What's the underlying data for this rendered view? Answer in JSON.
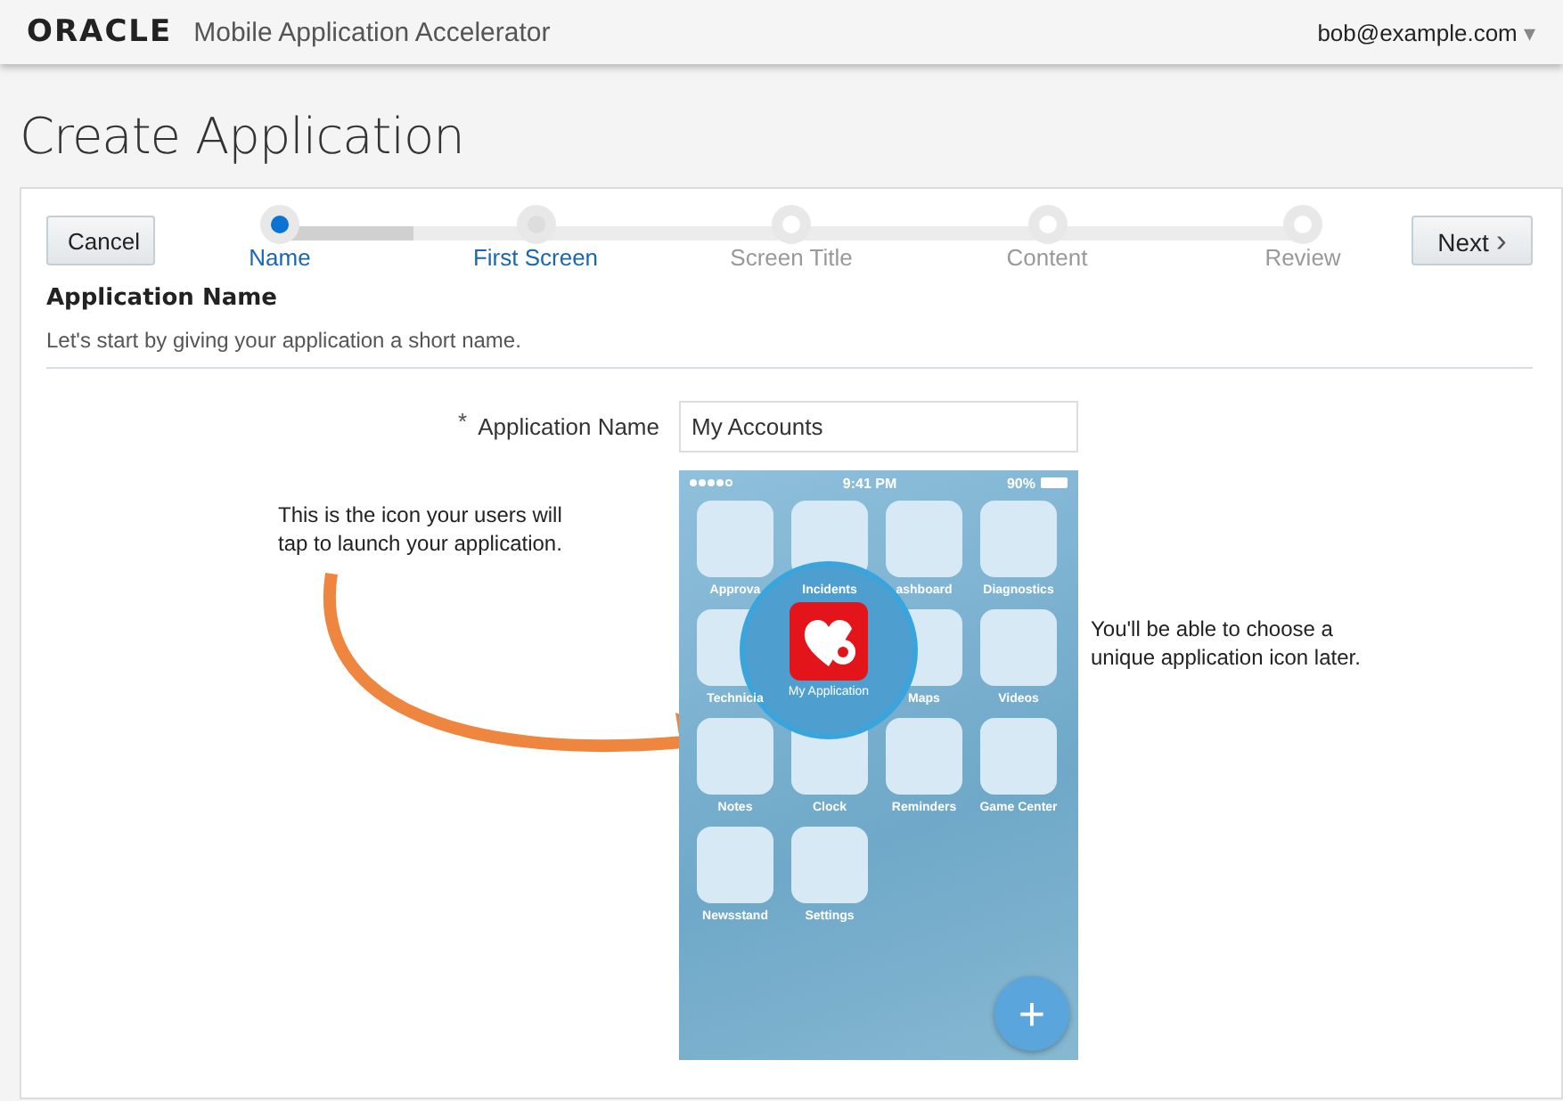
{
  "header": {
    "logo": "ORACLE",
    "product": "Mobile Application Accelerator",
    "user": "bob@example.com",
    "user_menu_glyph": "▾"
  },
  "page_title": "Create Application",
  "wizard": {
    "cancel": "Cancel",
    "next": "Next",
    "next_glyph": "›",
    "progress": {
      "level": 0.13
    },
    "steps": [
      {
        "label": "Name",
        "disabled": false,
        "selected": true
      },
      {
        "label": "First Screen",
        "disabled": false,
        "selected": false
      },
      {
        "label": "Screen Title",
        "disabled": true,
        "selected": false
      },
      {
        "label": "Content",
        "disabled": true,
        "selected": false
      },
      {
        "label": "Review",
        "disabled": true,
        "selected": false
      }
    ]
  },
  "section": {
    "title": "Application Name",
    "description": "Let's start by giving your application a short name."
  },
  "form": {
    "required_mark": "*",
    "label": "Application Name",
    "value": "My Accounts"
  },
  "callouts": [
    "This is the icon your users will tap to launch your application.",
    "You'll be able to choose a unique application icon later."
  ],
  "phone": {
    "time": "9:41 PM",
    "battery": "90%",
    "highlight_label": "My Application",
    "apps": [
      {
        "kind": "app",
        "label": "Approva"
      },
      {
        "kind": "app",
        "label": "Incidents"
      },
      {
        "kind": "app",
        "label": "ashboard"
      },
      {
        "kind": "app",
        "label": "Diagnostics"
      },
      {
        "kind": "app",
        "label": "Technicia"
      },
      {
        "kind": "magnified"
      },
      {
        "kind": "app",
        "label": "Maps"
      },
      {
        "kind": "app",
        "label": "Videos"
      },
      {
        "kind": "app",
        "label": "Notes"
      },
      {
        "kind": "app",
        "label": "Clock"
      },
      {
        "kind": "app",
        "label": "Reminders"
      },
      {
        "kind": "app",
        "label": "Game Center"
      },
      {
        "kind": "app",
        "label": "Newsstand"
      },
      {
        "kind": "app",
        "label": "Settings"
      }
    ],
    "fab": "+"
  }
}
